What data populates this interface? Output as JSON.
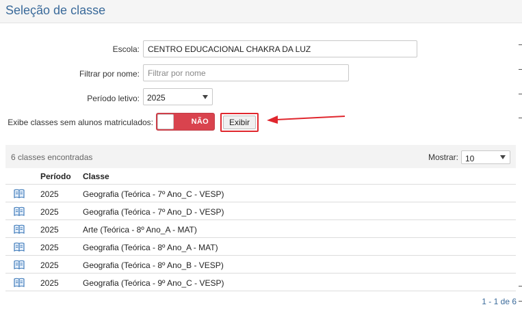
{
  "header": {
    "title": "Seleção de classe"
  },
  "form": {
    "escola_label": "Escola:",
    "escola_value": "CENTRO EDUCACIONAL CHAKRA DA LUZ",
    "filtrar_label": "Filtrar por nome:",
    "filtrar_placeholder": "Filtrar por nome",
    "periodo_label": "Período letivo:",
    "periodo_value": "2025",
    "exibe_label": "Exibe classes sem alunos matriculados:",
    "toggle_text": "NÃO",
    "exibir_button": "Exibir"
  },
  "results": {
    "count_text": "6 classes encontradas",
    "mostrar_label": "Mostrar:",
    "mostrar_value": "10"
  },
  "table": {
    "headers": {
      "periodo": "Período",
      "classe": "Classe"
    },
    "rows": [
      {
        "periodo": "2025",
        "classe": "Geografia (Teórica - 7º Ano_C - VESP)"
      },
      {
        "periodo": "2025",
        "classe": "Geografia (Teórica - 7º Ano_D - VESP)"
      },
      {
        "periodo": "2025",
        "classe": "Arte (Teórica - 8º Ano_A - MAT)"
      },
      {
        "periodo": "2025",
        "classe": "Geografia (Teórica - 8º Ano_A - MAT)"
      },
      {
        "periodo": "2025",
        "classe": "Geografia (Teórica - 8º Ano_B - VESP)"
      },
      {
        "periodo": "2025",
        "classe": "Geografia (Teórica - 9º Ano_C - VESP)"
      }
    ]
  },
  "pagination": {
    "text": "1 - 1 de 6"
  },
  "colors": {
    "accent": "#3a6a9a",
    "toggle_off": "#d9434e",
    "highlight": "#e0262d"
  },
  "icons": {
    "row_icon": "book-icon",
    "arrow": "red-arrow-icon"
  }
}
